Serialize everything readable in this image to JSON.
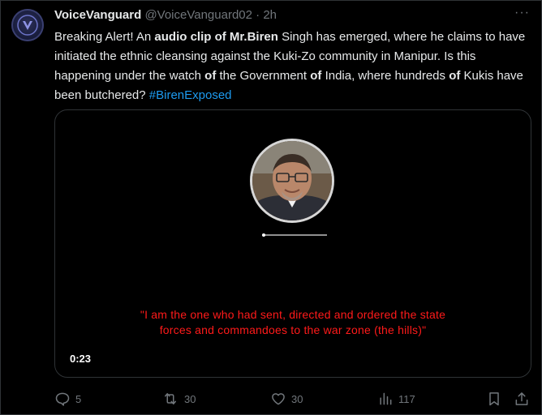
{
  "author": {
    "name": "VoiceVanguard",
    "handle": "@VoiceVanguard02",
    "separator": "·",
    "time": "2h"
  },
  "tweet": {
    "segments": [
      {
        "text": "Breaking Alert! An ",
        "bold": false
      },
      {
        "text": "audio clip of Mr.Biren",
        "bold": true
      },
      {
        "text": " Singh has emerged, where he claims to have initiated the ethnic cleansing against the Kuki-Zo community in Manipur. Is this happening under the watch ",
        "bold": false
      },
      {
        "text": "of",
        "bold": true
      },
      {
        "text": " the Government ",
        "bold": false
      },
      {
        "text": "of",
        "bold": true
      },
      {
        "text": " India, where hundreds ",
        "bold": false
      },
      {
        "text": "of",
        "bold": true
      },
      {
        "text": " Kukis have been butchered? ",
        "bold": false
      }
    ],
    "hashtag": "#BirenExposed"
  },
  "media": {
    "caption_line1": "\"I am the one who had sent, directed and ordered the state",
    "caption_line2": "forces and commandoes to the war zone (the hills)\"",
    "timecode": "0:23"
  },
  "actions": {
    "replies": "5",
    "retweets": "30",
    "likes": "30",
    "views": "117"
  },
  "colors": {
    "accent": "#1d9bf0",
    "caption": "#ff1a1a",
    "muted": "#71767b"
  },
  "icons": [
    "verified-logo-icon",
    "more-icon",
    "reply-icon",
    "retweet-icon",
    "like-icon",
    "views-icon",
    "bookmark-icon",
    "share-icon"
  ]
}
